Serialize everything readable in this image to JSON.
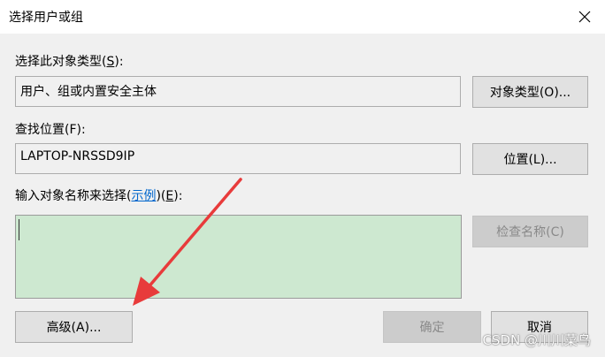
{
  "window": {
    "title": "选择用户或组",
    "close_icon": "close-icon"
  },
  "object_type": {
    "label_pre": "选择此对象类型(",
    "label_key": "S",
    "label_post": "):",
    "value": "用户、组或内置安全主体",
    "button_label": "对象类型(O)..."
  },
  "location": {
    "label": "查找位置(F):",
    "value": "LAPTOP-NRSSD9IP",
    "button_label": "位置(L)..."
  },
  "names": {
    "label_pre": "输入对象名称来选择(",
    "example_link": "示例",
    "label_mid": ")(",
    "label_key": "E",
    "label_post": "):",
    "value": "",
    "check_button_label": "检查名称(C)"
  },
  "footer": {
    "advanced_label": "高级(A)...",
    "ok_label": "确定",
    "cancel_label": "取消"
  },
  "annotation": {
    "arrow_color": "#e83b3b"
  },
  "watermark": {
    "text": "CSDN @川川菜鸟"
  }
}
